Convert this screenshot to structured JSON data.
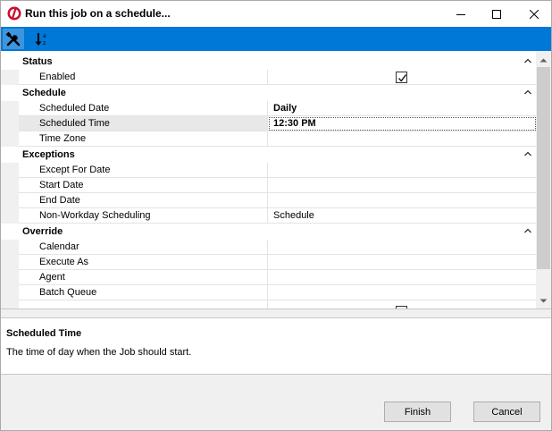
{
  "window": {
    "title": "Run this job on a schedule...",
    "icon": "app-logo-icon",
    "controls": [
      "minimize-icon",
      "maximize-icon",
      "close-icon"
    ]
  },
  "toolbar": {
    "items": [
      {
        "name": "categorized-view",
        "icon": "tools-icon",
        "active": true
      },
      {
        "name": "alphabetical-sort",
        "icon": "sort-az-icon",
        "active": false
      }
    ]
  },
  "grid": {
    "categories": {
      "status": {
        "label": "Status",
        "rows": [
          {
            "name": "Enabled",
            "checked": true
          }
        ]
      },
      "schedule": {
        "label": "Schedule",
        "rows": [
          {
            "name": "Scheduled Date",
            "value": "Daily"
          },
          {
            "name": "Scheduled Time",
            "value": "12:30 PM"
          },
          {
            "name": "Time Zone",
            "value": ""
          }
        ]
      },
      "exceptions": {
        "label": "Exceptions",
        "rows": [
          {
            "name": "Except For Date",
            "value": ""
          },
          {
            "name": "Start Date",
            "value": ""
          },
          {
            "name": "End Date",
            "value": ""
          },
          {
            "name": "Non-Workday Scheduling",
            "value": "Schedule"
          }
        ]
      },
      "override": {
        "label": "Override",
        "rows": [
          {
            "name": "Calendar",
            "value": ""
          },
          {
            "name": "Execute As",
            "value": ""
          },
          {
            "name": "Agent",
            "value": ""
          },
          {
            "name": "Batch Queue",
            "value": ""
          }
        ]
      }
    },
    "selected_row": "Scheduled Time",
    "accent_color": "#0078d7"
  },
  "description": {
    "title": "Scheduled Time",
    "text": "The time of day when the Job should start."
  },
  "buttons": {
    "finish": "Finish",
    "cancel": "Cancel"
  }
}
